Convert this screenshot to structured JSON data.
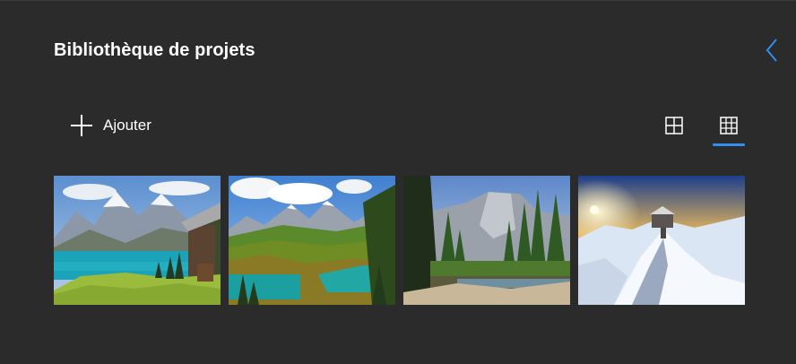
{
  "panel": {
    "title": "Bibliothèque de projets",
    "back_icon": "chevron-left-icon",
    "accent_color": "#2f8ef0"
  },
  "toolbar": {
    "add_label": "Ajouter",
    "add_icon": "plus-icon",
    "views": [
      {
        "icon": "grid-large-icon",
        "active": false
      },
      {
        "icon": "grid-small-icon",
        "active": true
      }
    ]
  },
  "library": {
    "items": [
      {
        "subject": "lake-chalet"
      },
      {
        "subject": "valley-lake"
      },
      {
        "subject": "canyon-river"
      },
      {
        "subject": "snowy-summit"
      }
    ]
  }
}
